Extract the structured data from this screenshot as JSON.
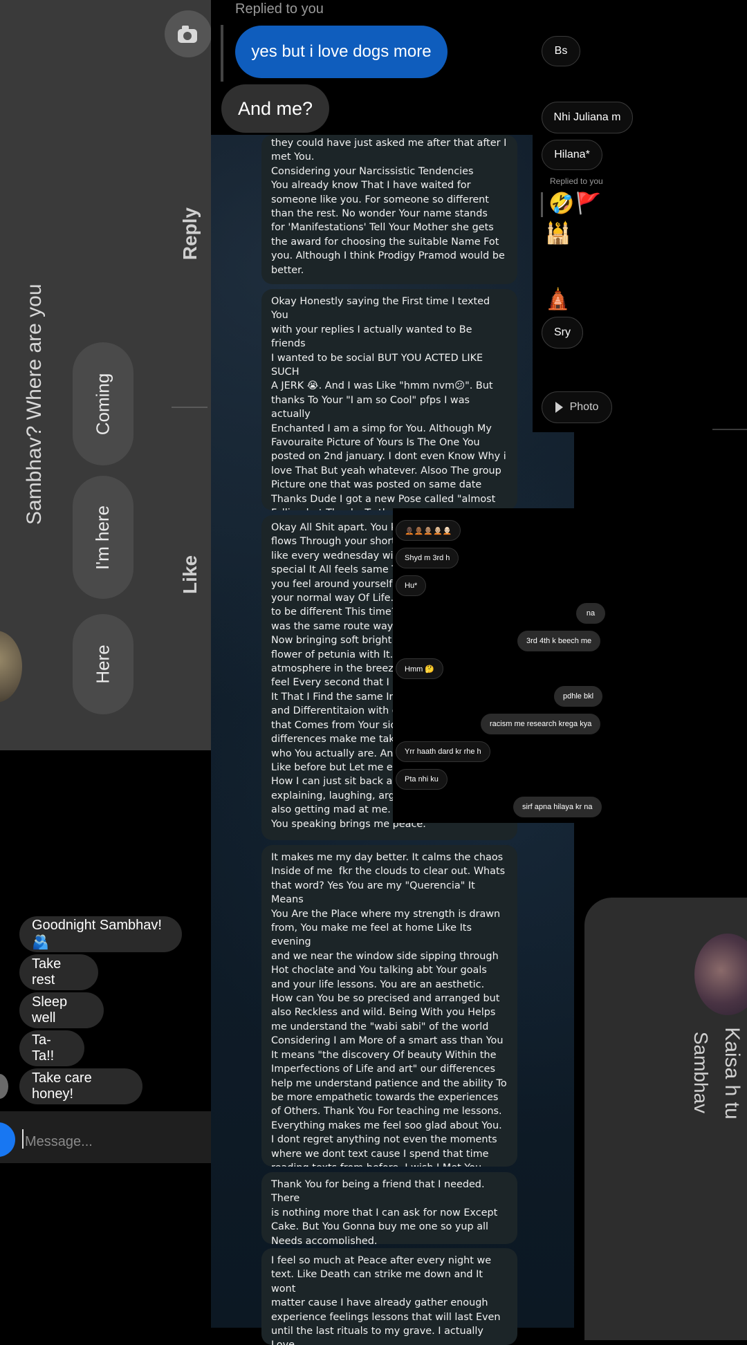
{
  "left_chat": {
    "header_text": "Sambhav? Where are you",
    "like_label": "Like",
    "reply_label": "Reply",
    "quick_replies": [
      "Coming",
      "I'm here",
      "Here"
    ],
    "messages": [
      "Goodnight Sambhav!🫂",
      "Take rest",
      "Sleep well",
      "Ta-Ta!!",
      "Take care honey!"
    ],
    "message_placeholder": "Message..."
  },
  "middle_chat": {
    "replied_label": "Replied to you",
    "replied_message": "yes but i love dogs more",
    "reply_message": "And me?",
    "letters": [
      "they could have just asked me after that after I\nmet You.\nConsidering your Narcissistic Tendencies\nYou already know That I have waited for\nsomeone like you. For someone so different\nthan the rest. No wonder Your name stands\nfor 'Manifestations' Tell Your Mother she gets\nthe award for choosing the suitable Name Fot\nyou. Although I think Prodigy Pramod would be\nbetter.",
      "Okay Honestly saying the First time I texted You\nwith your replies I actually wanted to Be friends\nI wanted to be social BUT YOU ACTED LIKE SUCH\nA JERK 😭. And I was Like \"hmm nvm😕\". But\nthanks To Your \"I am so Cool\" pfps I was actually\nEnchanted I am a simp for You. Although My\nFavouraite Picture of Yours Is The One You\nposted on 2nd january. I dont even Know Why i\nlove That But yeah whatever. Alsoo The group\nPicture one that was posted on same date\nThanks Dude I got a new Pose called \"almost\nFalling but Thanks To the Guy in the back for\nholding me\" sober But Unstable so Tru But Isnt\nthat You every second Of the day? So Ig that\ndoesnt needs to be mentioned.",
      "Okay All Shit apart. You k\nflows Through your short\nlike every wednesday wir\nspecial It All feels same T\nyou feel around yourself\nyour normal way Of Life.\nto be different This time?\nwas the same route way F\nNow bringing soft bright\nflower of petunia with It.\natmosphere in the breeze\nfeel Every second that I s\nIt That I Find the same Int\nand Differentitaion with c\nthat Comes from Your sid\ndifferences make me take\nwho You actually are. And\nLike before but Let me ex\nHow I can just sit back an\nexplaining, laughing, arg\nalso getting mad at me. It\nYou speaking brings me peace.",
      "It makes me my day better. It calms the chaos\nInside of me  fkr the clouds to clear out. Whats\nthat word? Yes You are my \"Querencia\" It Means\nYou Are the Place where my strength is drawn\nfrom, You make me feel at home Like Its evening\nand we near the window side sipping through\nHot choclate and You talking abt Your goals\nand your life lessons. You are an aesthetic.\nHow can You be so precised and arranged but\nalso Reckless and wild. Being With you Helps\nme understand the \"wabi sabi\" of the world\nConsidering I am More of a smart ass than You\nIt means \"the discovery Of beauty Within the\nImperfections of Life and art\" our differences\nhelp me understand patience and the ability To\nbe more empathetic towards the experiences\nof Others. Thank You For teaching me lessons.\nEverything makes me feel soo glad about You.\nI dont regret anything not even the moments\nwhere we dont text cause I spend that time\nreading texts from before. I wish I Met You\nearlier so I could have a better view Of The world",
      "Thank You for being a friend that I needed. There\nis nothing more that I can ask for now Except\nCake. But You Gonna buy me one so yup all\nNeeds accomplished.",
      "I feel so much at Peace after every night we\ntext. Like Death can strike me down and It wont\nmatter cause I have already gather enough\nexperience feelings lessons that will last Even\nuntil the last rituals to my grave. I actually Love"
    ]
  },
  "overlay_chat": {
    "messages": [
      {
        "text": "🧑🏿‍🦲🧑🏾‍🦲🧑🏽‍🦲🧑🏼‍🦲🧑🏻‍🦲",
        "side": "in"
      },
      {
        "text": "Shyd m 3rd h",
        "side": "in"
      },
      {
        "text": "Hu*",
        "side": "in"
      },
      {
        "text": "na",
        "side": "out"
      },
      {
        "text": "3rd 4th k beech me",
        "side": "out"
      },
      {
        "text": "Hmm 🤔",
        "side": "in"
      },
      {
        "text": "pdhle bkl",
        "side": "out"
      },
      {
        "text": "racism me research krega kya",
        "side": "out"
      },
      {
        "text": "Yrr haath dard kr rhe h",
        "side": "in"
      },
      {
        "text": "Pta nhi ku",
        "side": "in"
      },
      {
        "text": "sirf apna hilaya kr na",
        "side": "out"
      }
    ]
  },
  "right_chat": {
    "messages": [
      "Bs",
      "Nhi Juliana m",
      "Hilana*",
      "Sry"
    ],
    "replied_label": "Replied to you",
    "reaction_emojis": [
      "🤣",
      "🚩",
      "🕌",
      "🛕"
    ],
    "photo_label": "Photo"
  },
  "right_bottom": {
    "name": "Sambhav",
    "message": "Kaisa h tu"
  },
  "colors": {
    "blue_bubble": "#0f5dbd",
    "messenger_blue": "#1877f2",
    "letter_bubble": "#1c2528",
    "left_panel": "#3a3a3a"
  }
}
